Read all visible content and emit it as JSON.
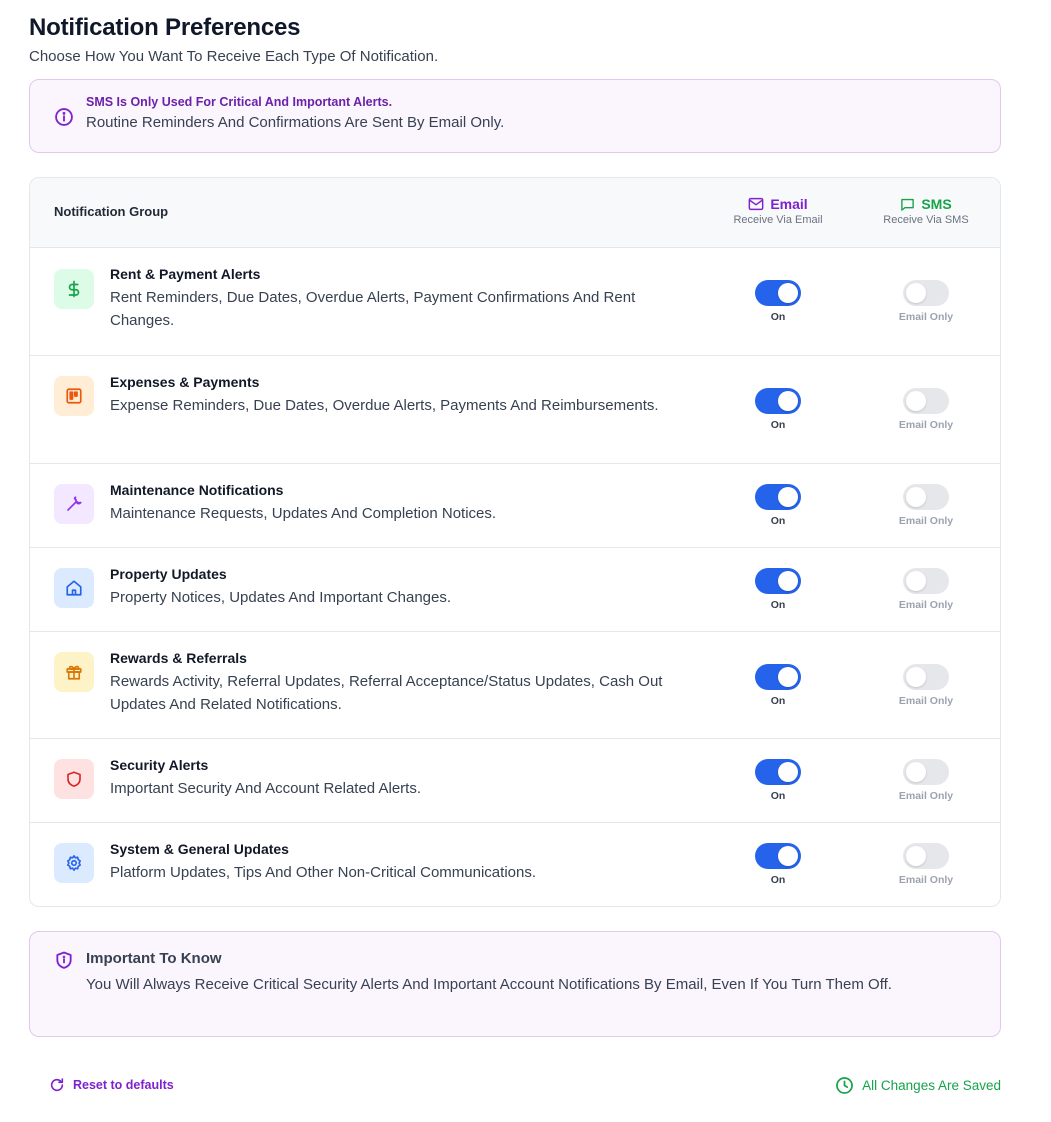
{
  "header": {
    "title": "Notification Preferences",
    "subtitle": "Choose How You Want To Receive Each Type Of Notification."
  },
  "info_banner": {
    "bold": "SMS Is Only Used For Critical And Important Alerts.",
    "text": "Routine Reminders And Confirmations Are Sent By Email Only."
  },
  "table": {
    "group_header": "Notification Group",
    "email_header": "Email",
    "email_sub": "Receive Via Email",
    "sms_header": "SMS",
    "sms_sub": "Receive Via SMS",
    "rows": [
      {
        "name": "Rent & Payment Alerts",
        "desc": "Rent Reminders, Due Dates, Overdue Alerts, Payment Confirmations And Rent Changes.",
        "icon": "dollar-icon",
        "email_on": true,
        "email_state": "On",
        "sms_on": false,
        "sms_state": "Email Only"
      },
      {
        "name": "Expenses & Payments",
        "desc": "Expense Reminders, Due Dates, Overdue Alerts, Payments And Reimbursements.",
        "icon": "board-icon",
        "email_on": true,
        "email_state": "On",
        "sms_on": false,
        "sms_state": "Email Only"
      },
      {
        "name": "Maintenance Notifications",
        "desc": "Maintenance Requests, Updates And Completion Notices.",
        "icon": "wrench-icon",
        "email_on": true,
        "email_state": "On",
        "sms_on": false,
        "sms_state": "Email Only"
      },
      {
        "name": "Property Updates",
        "desc": "Property Notices, Updates And Important Changes.",
        "icon": "home-icon",
        "email_on": true,
        "email_state": "On",
        "sms_on": false,
        "sms_state": "Email Only"
      },
      {
        "name": "Rewards & Referrals",
        "desc": "Rewards Activity, Referral Updates, Referral Acceptance/Status Updates, Cash Out Updates And Related Notifications.",
        "icon": "gift-icon",
        "email_on": true,
        "email_state": "On",
        "sms_on": false,
        "sms_state": "Email Only"
      },
      {
        "name": "Security Alerts",
        "desc": "Important Security And Account Related Alerts.",
        "icon": "shield-icon",
        "email_on": true,
        "email_state": "On",
        "sms_on": false,
        "sms_state": "Email Only"
      },
      {
        "name": "System & General Updates",
        "desc": "Platform Updates, Tips And Other Non-Critical Communications.",
        "icon": "gear-icon",
        "email_on": true,
        "email_state": "On",
        "sms_on": false,
        "sms_state": "Email Only"
      }
    ]
  },
  "note": {
    "title": "Important To Know",
    "text": "You Will Always Receive Critical Security Alerts And Important Account Notifications By Email, Even If You Turn Them Off."
  },
  "footer": {
    "reset_label": "Reset to defaults",
    "saved_label": "All Changes Are Saved"
  },
  "colors": {
    "accent_purple": "#7e22ce",
    "toggle_on": "#2563eb",
    "saved_green": "#16a34a"
  }
}
